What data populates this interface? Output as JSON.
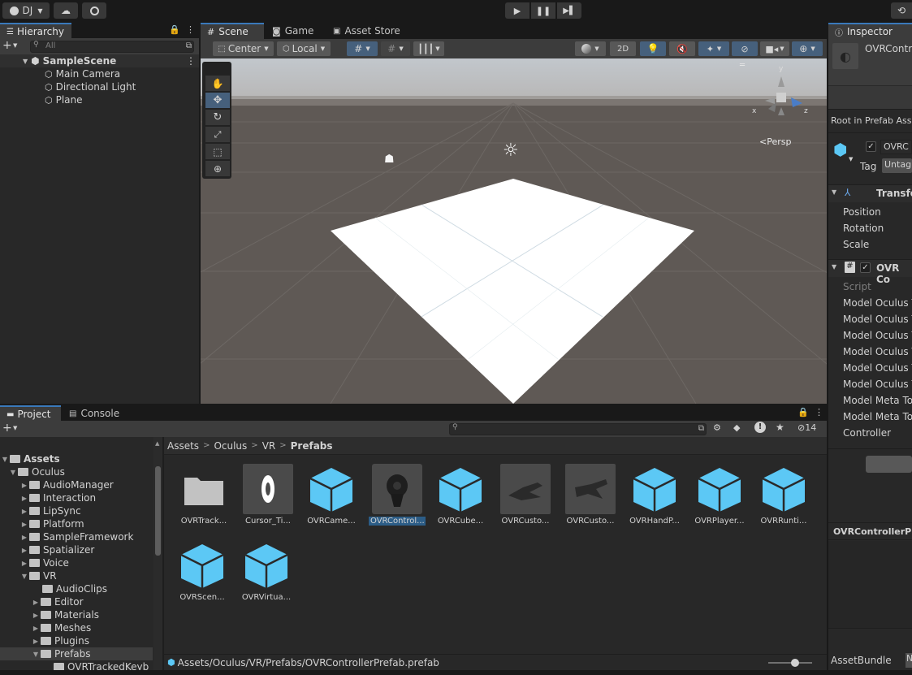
{
  "toolbar": {
    "account_label": "DJ",
    "account_icon": "user-icon",
    "cloud_icon": "cloud-icon",
    "collab_icon": "collab-icon",
    "play_icon": "play-icon",
    "pause_icon": "pause-icon",
    "step_icon": "step-icon",
    "history_icon": "history-icon"
  },
  "hierarchy": {
    "tab_label": "Hierarchy",
    "search_placeholder": "All",
    "scene_name": "SampleScene",
    "items": [
      {
        "label": "Main Camera"
      },
      {
        "label": "Directional Light"
      },
      {
        "label": "Plane"
      }
    ]
  },
  "scene_view": {
    "tabs": [
      {
        "label": "Scene"
      },
      {
        "label": "Game"
      },
      {
        "label": "Asset Store"
      }
    ],
    "pivot_label": "Center",
    "space_label": "Local",
    "mode_2d": "2D",
    "persp_label": "Persp",
    "gizmo_x": "x",
    "gizmo_y": "y",
    "gizmo_z": "z"
  },
  "project": {
    "tabs": [
      {
        "label": "Project"
      },
      {
        "label": "Console"
      }
    ],
    "hidden_count": "14",
    "breadcrumb": [
      "Assets",
      "Oculus",
      "VR",
      "Prefabs"
    ],
    "tree": [
      {
        "label": "Assets"
      },
      {
        "label": "Oculus"
      },
      {
        "label": "AudioManager"
      },
      {
        "label": "Interaction"
      },
      {
        "label": "LipSync"
      },
      {
        "label": "Platform"
      },
      {
        "label": "SampleFramework"
      },
      {
        "label": "Spatializer"
      },
      {
        "label": "Voice"
      },
      {
        "label": "VR"
      },
      {
        "label": "AudioClips"
      },
      {
        "label": "Editor"
      },
      {
        "label": "Materials"
      },
      {
        "label": "Meshes"
      },
      {
        "label": "Plugins"
      },
      {
        "label": "Prefabs"
      },
      {
        "label": "OVRTrackedKeyb"
      }
    ],
    "assets": [
      {
        "label": "OVRTrack...",
        "kind": "folder"
      },
      {
        "label": "Cursor_Ti...",
        "kind": "cursor"
      },
      {
        "label": "OVRCame...",
        "kind": "prefab"
      },
      {
        "label": "OVRControl...",
        "kind": "controller"
      },
      {
        "label": "OVRCube...",
        "kind": "prefab"
      },
      {
        "label": "OVRCusto...",
        "kind": "hand"
      },
      {
        "label": "OVRCusto...",
        "kind": "hand"
      },
      {
        "label": "OVRHandP...",
        "kind": "prefab"
      },
      {
        "label": "OVRPlayer...",
        "kind": "prefab"
      },
      {
        "label": "OVRRunti...",
        "kind": "prefab"
      },
      {
        "label": "OVRScen...",
        "kind": "prefab"
      },
      {
        "label": "OVRVirtua...",
        "kind": "prefab"
      }
    ],
    "status_path": "Assets/Oculus/VR/Prefabs/OVRControllerPrefab.prefab"
  },
  "inspector": {
    "tab_label": "Inspector",
    "object_name": "OVRContr",
    "root_prefab_label": "Root in Prefab Ass",
    "go_name": "OVRC",
    "tag_label": "Tag",
    "tag_value": "Untag",
    "transform_label": "Transfo",
    "transform_rows": [
      "Position",
      "Rotation",
      "Scale"
    ],
    "component_label": "OVR Co",
    "component_rows": [
      "Script",
      "Model Oculus T",
      "Model Oculus T",
      "Model Oculus T",
      "Model Oculus T",
      "Model Oculus T",
      "Model Oculus T",
      "Model Meta To",
      "Model Meta To",
      "Controller"
    ],
    "footer_name": "OVRControllerPr",
    "assetbundle_label": "AssetBundle",
    "assetbundle_value": "N"
  },
  "colors": {
    "accent": "#3a79bb",
    "prefab_blue": "#5cc8f5",
    "panel": "#282828",
    "toolbar": "#191919"
  }
}
